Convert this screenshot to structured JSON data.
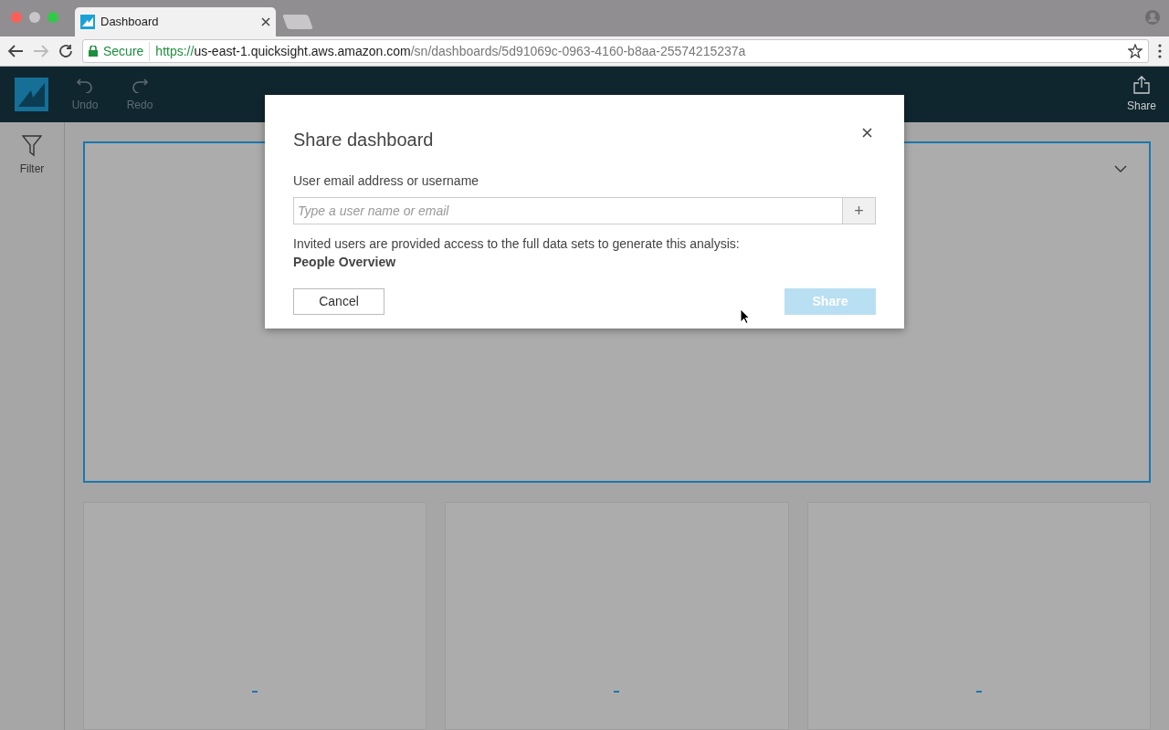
{
  "browser": {
    "tab_title": "Dashboard",
    "url": {
      "secure_label": "Secure",
      "scheme": "https://",
      "host": "us-east-1.quicksight.aws.amazon.com",
      "path": "/sn/dashboards/5d91069c-0963-4160-b8aa-25574215237a"
    }
  },
  "app_header": {
    "tools": [
      {
        "kind": "undo",
        "label": "Undo",
        "disabled": true
      },
      {
        "kind": "redo",
        "label": "Redo",
        "disabled": true
      }
    ],
    "share_label": "Share"
  },
  "sidebar": {
    "items": [
      {
        "label": "Filter"
      }
    ]
  },
  "dialog": {
    "title": "Share dashboard",
    "field_label": "User email address or username",
    "placeholder": "Type a user name or email",
    "add_button": "+",
    "note": "Invited users are provided access to the full data sets to generate this analysis:",
    "dataset": "People Overview",
    "cancel": "Cancel",
    "share": {
      "label": "Share",
      "disabled": true
    }
  }
}
